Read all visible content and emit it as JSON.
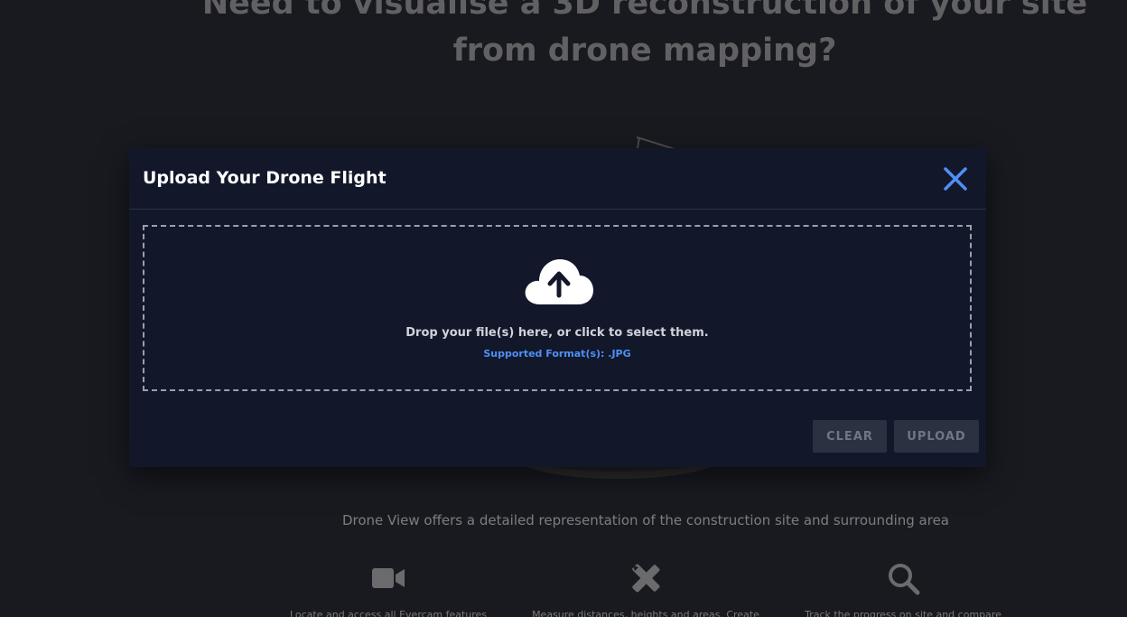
{
  "background": {
    "heading": "Need to visualise a 3D reconstruction of your site from drone mapping?",
    "tagline": "Drone View offers a detailed representation of the construction site and surrounding area",
    "features": [
      {
        "icon": "video-camera-icon",
        "text": "Locate and access all Evercam features"
      },
      {
        "icon": "ruler-pencil-icon",
        "text": "Measure distances, heights and areas. Create"
      },
      {
        "icon": "search-icon",
        "text": "Track the progress on site and compare"
      }
    ]
  },
  "modal": {
    "title": "Upload Your Drone Flight",
    "dropzone": {
      "icon": "cloud-upload-icon",
      "text": "Drop your file(s) here, or click to select them.",
      "formats": "Supported Format(s): .JPG"
    },
    "buttons": {
      "clear": "CLEAR",
      "upload": "UPLOAD"
    }
  },
  "colors": {
    "accent": "#4f8ff7",
    "modal_bg": "#121829",
    "page_bg": "#1c1f25",
    "button_disabled_bg": "#2a3140"
  }
}
